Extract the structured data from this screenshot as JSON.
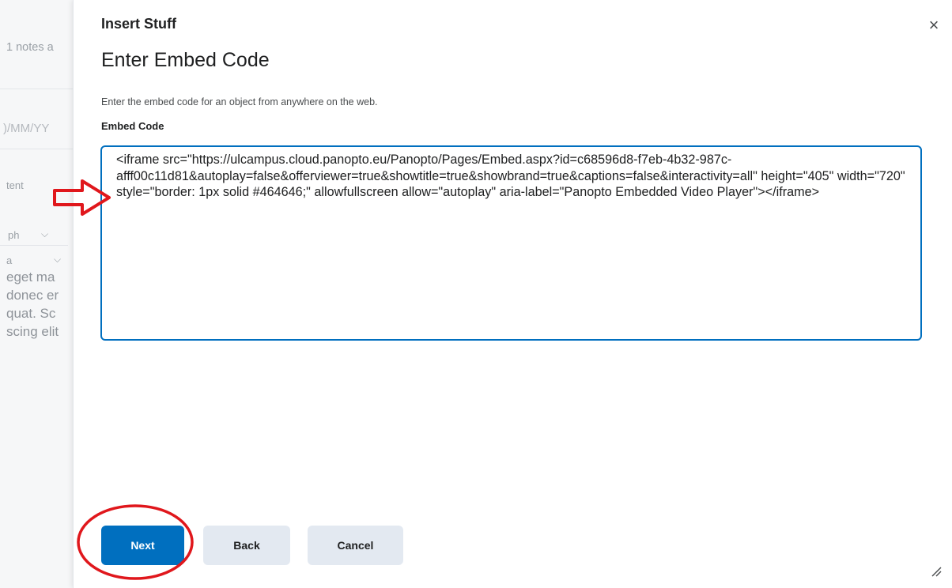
{
  "background": {
    "notes_text": "1 notes a",
    "date_placeholder": ")/MM/YY",
    "content_label": "tent",
    "format_select": "ph",
    "font_select": "a",
    "body_lines": [
      "eget ma",
      "donec er",
      "quat. Sc",
      "scing elit"
    ]
  },
  "dialog": {
    "title": "Insert Stuff",
    "close_symbol": "×",
    "step_title": "Enter Embed Code",
    "help_text": "Enter the embed code for an object from anywhere on the web.",
    "field_label": "Embed Code",
    "embed_code": "<iframe src=\"https://ulcampus.cloud.panopto.eu/Panopto/Pages/Embed.aspx?id=c68596d8-f7eb-4b32-987c-afff00c11d81&autoplay=false&offerviewer=true&showtitle=true&showbrand=true&captions=false&interactivity=all\" height=\"405\" width=\"720\" style=\"border: 1px solid #464646;\" allowfullscreen allow=\"autoplay\" aria-label=\"Panopto Embedded Video Player\"></iframe>",
    "buttons": {
      "next": "Next",
      "back": "Back",
      "cancel": "Cancel"
    }
  },
  "colors": {
    "primary": "#006fbf",
    "secondary_button": "#e3e9f1",
    "annotation": "#e0171c"
  }
}
